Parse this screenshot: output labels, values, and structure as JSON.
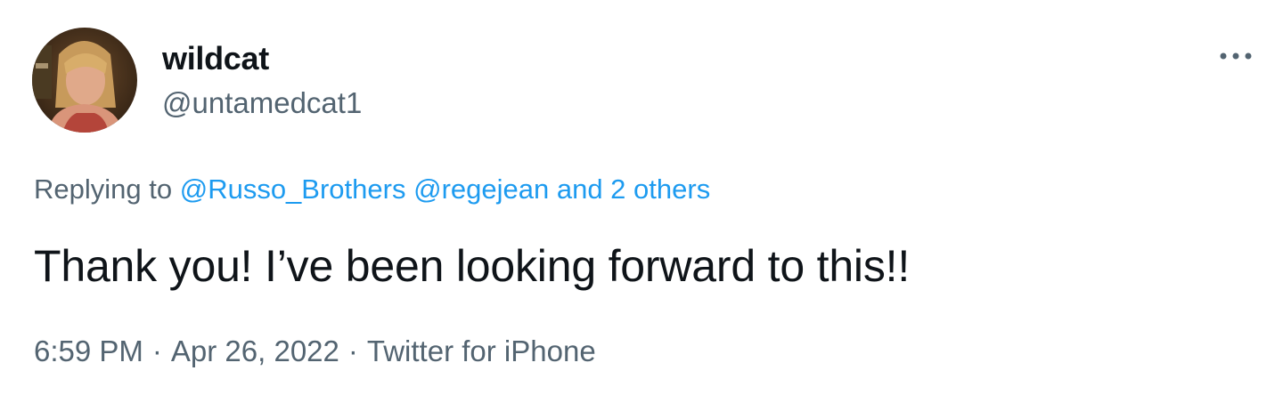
{
  "user": {
    "display_name": "wildcat",
    "handle": "@untamedcat1"
  },
  "reply": {
    "prefix": "Replying to",
    "mention_1": "@Russo_Brothers",
    "mention_2": "@regejean",
    "others": "and 2 others"
  },
  "tweet": {
    "text": "Thank you! I’ve been looking forward to this!!"
  },
  "meta": {
    "time": "6:59 PM",
    "date": "Apr 26, 2022",
    "source": "Twitter for iPhone",
    "separator": "·"
  },
  "colors": {
    "text": "#0f1419",
    "secondary": "#536471",
    "link": "#1d9bf0"
  },
  "icons": {
    "more": "more-horizontal-icon"
  }
}
